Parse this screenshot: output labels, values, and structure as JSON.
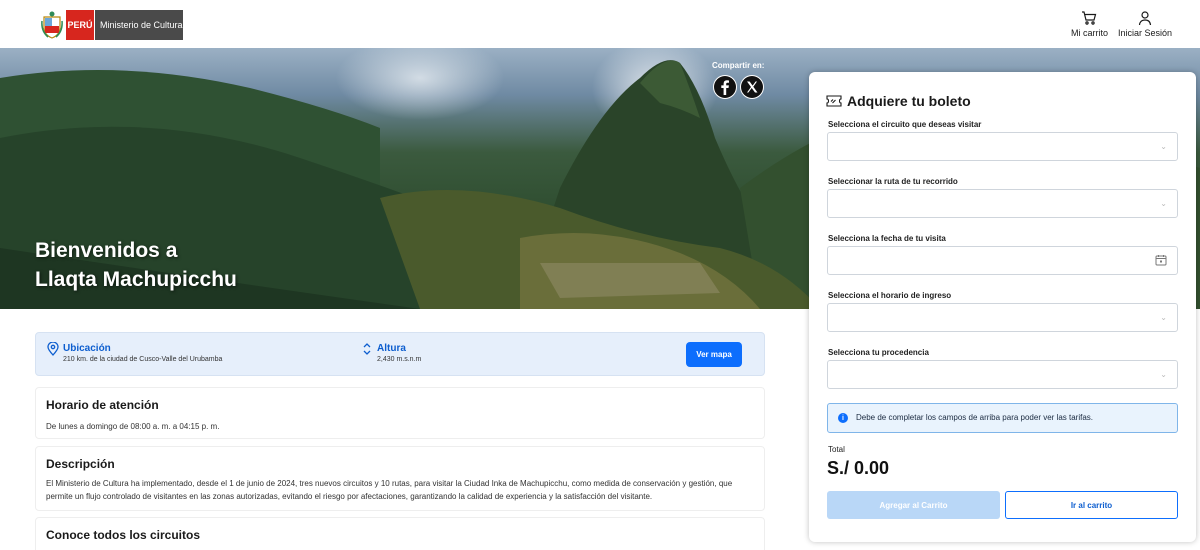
{
  "header": {
    "logo_peru": "PERÚ",
    "logo_ministry": "Ministerio de Cultura",
    "cart_label": "Mi carrito",
    "login_label": "Iniciar Sesión"
  },
  "hero": {
    "title_line1": "Bienvenidos a",
    "title_line2": "Llaqta Machupicchu",
    "share_label": "Compartir en:"
  },
  "info": {
    "location_label": "Ubicación",
    "location_value": "210 km. de la ciudad de Cusco-Valle del Urubamba",
    "altitude_label": "Altura",
    "altitude_value": "2,430 m.s.n.m",
    "map_button": "Ver mapa"
  },
  "schedule": {
    "title": "Horario de atención",
    "text": "De lunes a domingo de 08:00 a. m. a 04:15 p. m."
  },
  "description": {
    "title": "Descripción",
    "text": "El Ministerio de Cultura ha implementado, desde el 1 de junio de 2024, tres nuevos circuitos y 10 rutas, para visitar la Ciudad Inka de Machupicchu, como medida de conservación y gestión, que permite un flujo controlado de visitantes en las zonas autorizadas, evitando el riesgo por afectaciones, garantizando la calidad de experiencia y la satisfacción del visitante."
  },
  "circuits": {
    "title": "Conoce todos los circuitos"
  },
  "ticket": {
    "title": "Adquiere tu boleto",
    "fields": [
      {
        "label": "Selecciona el circuito que deseas visitar",
        "value": ""
      },
      {
        "label": "Seleccionar la ruta de tu recorrido",
        "value": ""
      },
      {
        "label": "Selecciona la fecha de tu visita",
        "value": ""
      },
      {
        "label": "Selecciona el horario de ingreso",
        "value": ""
      },
      {
        "label": "Selecciona tu procedencia",
        "value": ""
      }
    ],
    "notice": "Debe de completar los campos de arriba para poder ver las tarifas.",
    "total_label": "Total",
    "total_value": "S./ 0.00",
    "add_button": "Agregar al Carrito",
    "cart_button": "Ir al carrito"
  },
  "colors": {
    "primary": "#0d6efd",
    "peru_red": "#d7261e",
    "info_bg": "#e6effb"
  }
}
